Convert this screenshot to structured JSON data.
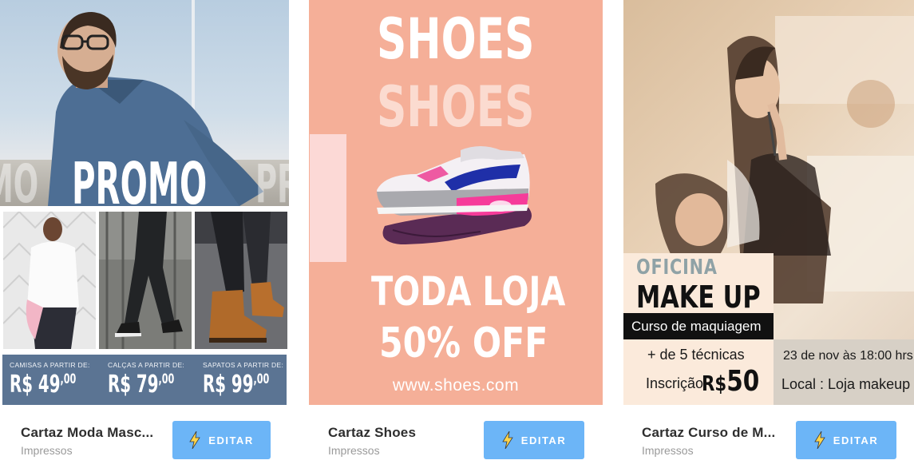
{
  "cards": [
    {
      "title": "Cartaz Moda Masc...",
      "subtitle": "Impressos",
      "button_label": "EDITAR",
      "poster": {
        "headline": "PROMO",
        "ghost_left": "MO",
        "ghost_right": "PR",
        "prices": [
          {
            "caption": "CAMISAS A PARTIR DE:",
            "currency": "R$",
            "amount": "49",
            "cents": "00"
          },
          {
            "caption": "CALÇAS A PARTIR DE:",
            "currency": "R$",
            "amount": "79",
            "cents": "00"
          },
          {
            "caption": "SAPATOS A PARTIR DE:",
            "currency": "R$",
            "amount": "99",
            "cents": "00"
          }
        ],
        "colors": {
          "price_bar": "#5b7493"
        }
      }
    },
    {
      "title": "Cartaz Shoes",
      "subtitle": "Impressos",
      "button_label": "EDITAR",
      "poster": {
        "headline": "SHOES",
        "headline_echo": "SHOES",
        "line1": "TODA LOJA",
        "line2": "50% OFF",
        "url": "www.shoes.com",
        "colors": {
          "background": "#f5af98",
          "accent_block": "#fcd9d6"
        }
      }
    },
    {
      "title": "Cartaz Curso de M...",
      "subtitle": "Impressos",
      "button_label": "EDITAR",
      "poster": {
        "kicker": "OFICINA",
        "headline": "MAKE UP",
        "banner": "Curso de maquiagem",
        "feature": "+ de 5 técnicas",
        "price_label": "Inscrição",
        "price_currency": "R$",
        "price_amount": "50",
        "date": "23 de nov  às 18:00 hrs",
        "location": "Local : Loja makeup"
      }
    }
  ],
  "icons": {
    "edit_button_icon": "lightning-bolt-icon"
  },
  "colors": {
    "button": "#6cb5f7",
    "title_text": "#2e2e2e",
    "subtitle_text": "#9a9a9a"
  }
}
